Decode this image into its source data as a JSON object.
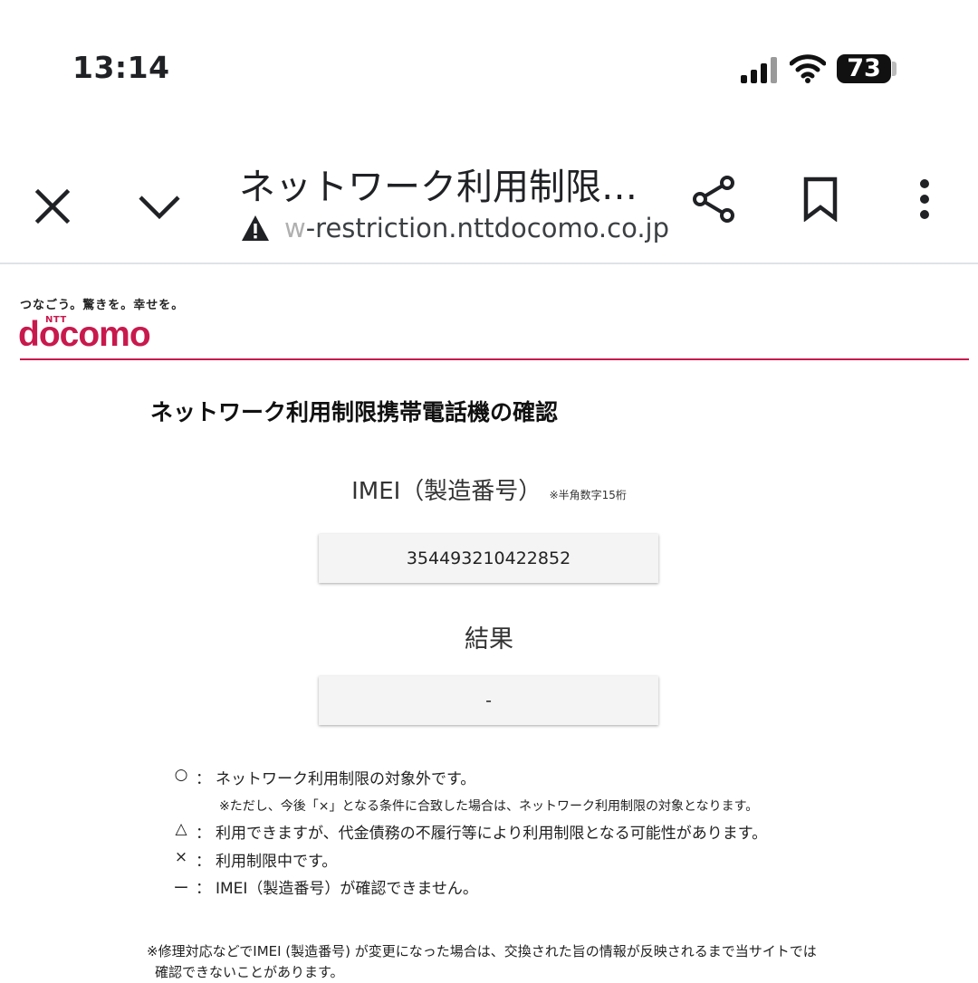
{
  "status_bar": {
    "time": "13:14",
    "battery": "73"
  },
  "browser": {
    "page_title": "ネットワーク利用制限…",
    "url_faded": "w",
    "url": "-restriction.nttdocomo.co.jp"
  },
  "brand": {
    "tagline": "つなごう。驚きを。幸せを。",
    "ntt": "NTT",
    "logo": "docomo",
    "accent_color": "#c8194d"
  },
  "main": {
    "heading": "ネットワーク利用制限携帯電話機の確認",
    "imei_label": "IMEI（製造番号）",
    "imei_note": "※半角数字15桁",
    "imei_value": "354493210422852",
    "result_label": "結果",
    "result_value": "-"
  },
  "legend": [
    {
      "symbol": "○",
      "colon": "：",
      "text": "ネットワーク利用制限の対象外です。"
    },
    {
      "note": "※ただし、今後「×」となる条件に合致した場合は、ネットワーク利用制限の対象となります。"
    },
    {
      "symbol": "△",
      "colon": "：",
      "text": "利用できますが、代金債務の不履行等により利用制限となる可能性があります。"
    },
    {
      "symbol": "×",
      "colon": "：",
      "text": "利用制限中です。"
    },
    {
      "symbol": "ー",
      "colon": "：",
      "text": "IMEI（製造番号）が確認できません。"
    }
  ],
  "footnote": [
    "※修理対応などでIMEI (製造番号) が変更になった場合は、交換された旨の情報が反映されるまで当サイトでは",
    "確認できないことがあります。"
  ],
  "icons": [
    "signal-icon",
    "wifi-icon",
    "battery-icon",
    "close-icon",
    "chevron-down-icon",
    "warning-icon",
    "share-icon",
    "bookmark-icon",
    "more-vert-icon"
  ]
}
